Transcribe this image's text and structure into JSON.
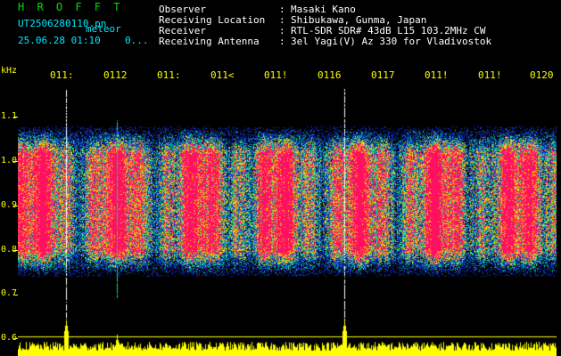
{
  "colors": {
    "background": "#000000",
    "brand_text": "#00e000",
    "header_text": "#ffffff",
    "file_info_text": "#00e8ff",
    "axis_text": "#ffff00",
    "signal_core": "#ff1060",
    "signal_mid": "#ffd000",
    "signal_low": "#00d8a0",
    "noise": "#1030c0",
    "echo_line": "#ffffff",
    "bottom_trace": "#ffff00"
  },
  "brand": "H R O F F T",
  "file_info": {
    "file_name": "UT2506280110.pn",
    "mode_label": "meteor",
    "datetime": "25.06.28 01:10",
    "dots": "0..."
  },
  "header": {
    "rows": [
      {
        "label": "Observer",
        "colon": ":",
        "value": "Masaki Kano"
      },
      {
        "label": "Receiving Location",
        "colon": ":",
        "value": "Shibukawa, Gunma, Japan"
      },
      {
        "label": "Receiver",
        "colon": ":",
        "value": "RTL-SDR SDR# 43dB L15 103.2MHz CW"
      },
      {
        "label": "Receiving Antenna",
        "colon": ":",
        "value": "3el Yagi(V) Az 330 for Vladivostok"
      }
    ]
  },
  "axis": {
    "y_unit": "kHz",
    "y_ticks": [
      "1.1",
      "1.0",
      "0.9",
      "0.8",
      "0.7",
      "0.6"
    ],
    "x_ticks": [
      "011:",
      "0112",
      "011:",
      "011<",
      "011!",
      "0116",
      "0117",
      "011!",
      "011!",
      "0120"
    ]
  },
  "events": {
    "echo_minutes": [
      0.9,
      1.85,
      6.1
    ],
    "strong_echo_minutes": [
      0.9,
      6.1
    ]
  }
}
